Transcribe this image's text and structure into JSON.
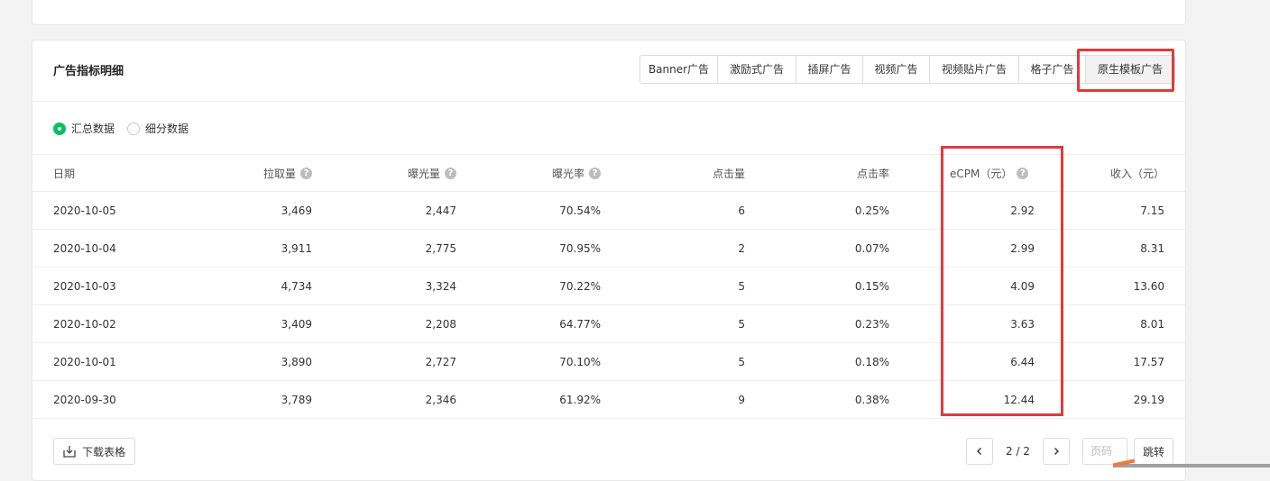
{
  "card": {
    "title": "广告指标明细",
    "tabs": [
      "Banner广告",
      "激励式广告",
      "插屏广告",
      "视频广告",
      "视频贴片广告",
      "格子广告",
      "原生模板广告"
    ],
    "active_tab": "原生模板广告"
  },
  "radios": [
    {
      "label": "汇总数据",
      "checked": true
    },
    {
      "label": "细分数据",
      "checked": false
    }
  ],
  "table": {
    "headers": [
      "日期",
      "拉取量",
      "曝光量",
      "曝光率",
      "点击量",
      "点击率",
      "eCPM（元）",
      "收入（元）"
    ],
    "rows": [
      [
        "2020-10-05",
        "3,469",
        "2,447",
        "70.54%",
        "6",
        "0.25%",
        "2.92",
        "7.15"
      ],
      [
        "2020-10-04",
        "3,911",
        "2,775",
        "70.95%",
        "2",
        "0.07%",
        "2.99",
        "8.31"
      ],
      [
        "2020-10-03",
        "4,734",
        "3,324",
        "70.22%",
        "5",
        "0.15%",
        "4.09",
        "13.60"
      ],
      [
        "2020-10-02",
        "3,409",
        "2,208",
        "64.77%",
        "5",
        "0.23%",
        "3.63",
        "8.01"
      ],
      [
        "2020-10-01",
        "3,890",
        "2,727",
        "70.10%",
        "5",
        "0.18%",
        "6.44",
        "17.57"
      ],
      [
        "2020-09-30",
        "3,789",
        "2,346",
        "61.92%",
        "9",
        "0.38%",
        "12.44",
        "29.19"
      ]
    ]
  },
  "footer": {
    "download_label": "下载表格",
    "page_info": "2 / 2",
    "page_input_placeholder": "页码",
    "jump_label": "跳转"
  },
  "colors": {
    "accent": "#07c160",
    "highlight": "#e03b3b"
  },
  "icons": {
    "help": "question-circle-icon",
    "download": "download-icon",
    "prev": "chevron-left-icon",
    "next": "chevron-right-icon"
  }
}
